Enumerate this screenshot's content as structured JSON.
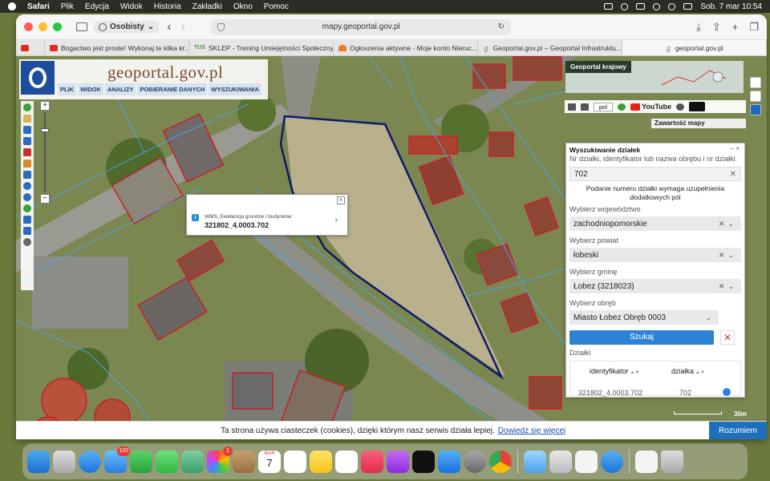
{
  "menubar": {
    "app": "Safari",
    "items": [
      "Plik",
      "Edycja",
      "Widok",
      "Historia",
      "Zakładki",
      "Okno",
      "Pomoc"
    ],
    "clock": "Sob. 7 mar  10:54"
  },
  "browser": {
    "profile": "Osobisty",
    "url": "mapy.geoportal.gov.pl",
    "tabs": [
      {
        "label": "Bogactwo jest proste! Wykonaj te kilka kr...",
        "fav": "#e02b20"
      },
      {
        "label": "SKLEP - Trening Umiejętności Społecznych",
        "fav": "tus"
      },
      {
        "label": "Ogłoszenia aktywne - Moje konto Nieruc...",
        "fav": "#f07b2a"
      },
      {
        "label": "Geoportal.gov.pl – Geoportal Infrastruktu...",
        "fav": "#888"
      },
      {
        "label": "geoportal.gov.pl",
        "fav": "#888"
      }
    ],
    "tus_label": "TUS"
  },
  "geoportal": {
    "title": "geoportal.gov.pl",
    "menu": [
      "PLIK",
      "WIDOK",
      "ANALIZY",
      "POBIERANIE DANYCH",
      "WYSZUKIWANIA"
    ],
    "minimap_label": "Geoportal krajowy",
    "lang": "pol",
    "youtube": "YouTube",
    "layers_title": "Zawartość mapy",
    "scale": "30m"
  },
  "popup": {
    "source": "WMS, Ewidencja gruntów i budynków",
    "value": "321802_4.0003.702"
  },
  "search_panel": {
    "title": "Wyszukiwanie działek",
    "field_label": "Nr działki, identyfikator lub nazwa obrębu i nr działki",
    "field_value": "702",
    "note": "Podanie numeru działki wymaga uzupełnienia dodatkowych pól",
    "selects": [
      {
        "label": "Wybierz województwo",
        "value": "zachodniopomorskie"
      },
      {
        "label": "Wybierz powiat",
        "value": "łobeski"
      },
      {
        "label": "Wybierz gminę",
        "value": "Łobez (3218023)"
      },
      {
        "label": "Wybierz obręb",
        "value": "Miasto Łobez Obręb 0003"
      }
    ],
    "search_button": "Szukaj",
    "clear_button": "✕",
    "results_label": "Działki",
    "col_id": "identyfikator",
    "col_parcel": "działka",
    "row_id": "321802_4.0003.702",
    "row_parcel": "702"
  },
  "cookie": {
    "text": "Ta strona używa ciasteczek (cookies), dzięki którym nasz serwis działa lepiej.",
    "link": "Dowiedz się więcej",
    "button": "Rozumiem"
  },
  "dock": {
    "mail_badge": "100",
    "facetime_badge": "1",
    "calendar_month": "MAR",
    "calendar_day": "7"
  }
}
